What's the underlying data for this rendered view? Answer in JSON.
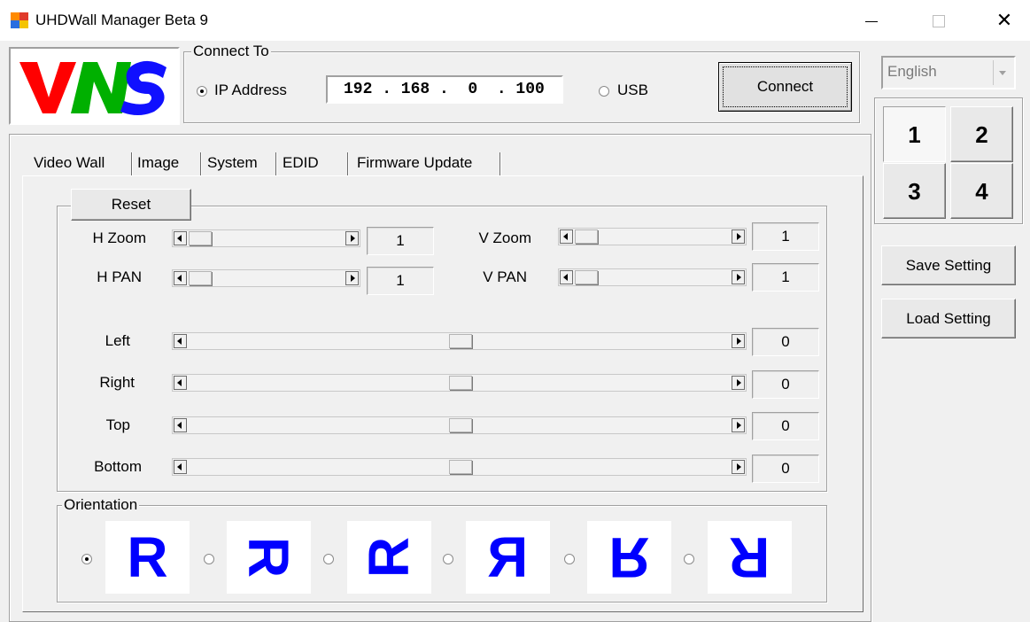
{
  "window": {
    "title": "UHDWall Manager Beta  9",
    "minimize_glyph": "—",
    "close_glyph": "✕"
  },
  "logo": {
    "text": "VNS",
    "colors": [
      "#ff0000",
      "#00aa00",
      "#1010ff"
    ]
  },
  "connect": {
    "group_label": "Connect To",
    "ip_label": "IP Address",
    "ip_value": "192 . 168 .  0  . 100",
    "ip_selected": true,
    "usb_label": "USB",
    "usb_selected": false,
    "button_label": "Connect"
  },
  "language": {
    "selected": "English"
  },
  "quadrants": [
    "1",
    "2",
    "3",
    "4"
  ],
  "side_buttons": {
    "save": "Save Setting",
    "load": "Load Setting"
  },
  "tabs": [
    "Video Wall",
    "Image",
    "System",
    "EDID",
    "Firmware Update"
  ],
  "video_wall": {
    "reset_label": "Reset",
    "h_zoom": {
      "label": "H Zoom",
      "value": "1"
    },
    "v_zoom": {
      "label": "V Zoom",
      "value": "1"
    },
    "h_pan": {
      "label": "H PAN",
      "value": "1"
    },
    "v_pan": {
      "label": "V PAN",
      "value": "1"
    },
    "left": {
      "label": "Left",
      "value": "0"
    },
    "right": {
      "label": "Right",
      "value": "0"
    },
    "top": {
      "label": "Top",
      "value": "0"
    },
    "bottom": {
      "label": "Bottom",
      "value": "0"
    },
    "orientation_label": "Orientation",
    "orientations": [
      {
        "glyph": "R",
        "selected": true
      },
      {
        "glyph": "R",
        "selected": false
      },
      {
        "glyph": "R",
        "selected": false
      },
      {
        "glyph": "R",
        "selected": false
      },
      {
        "glyph": "R",
        "selected": false
      },
      {
        "glyph": "R",
        "selected": false
      }
    ]
  }
}
